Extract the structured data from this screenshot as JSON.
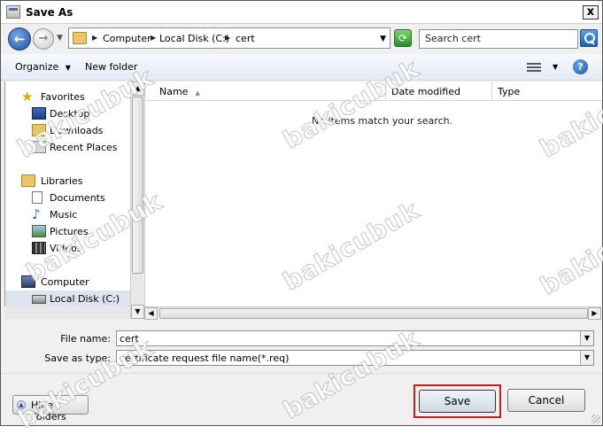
{
  "window": {
    "title": "Save As",
    "close_glyph": "x"
  },
  "address": {
    "back_glyph": "←",
    "forward_glyph": "→",
    "breadcrumbs": [
      "Computer",
      "Local Disk (C:)",
      "cert"
    ],
    "search_placeholder": "Search cert"
  },
  "toolbar": {
    "organize": "Organize",
    "new_folder": "New folder",
    "help_glyph": "?"
  },
  "nav": {
    "favorites": "Favorites",
    "desktop": "Desktop",
    "downloads": "Downloads",
    "recent": "Recent Places",
    "libraries": "Libraries",
    "documents": "Documents",
    "music": "Music",
    "pictures": "Pictures",
    "videos": "Videos",
    "computer": "Computer",
    "local_disk": "Local Disk (C:)"
  },
  "list": {
    "columns": [
      "Name",
      "Date modified",
      "Type"
    ],
    "empty_message": "No items match your search."
  },
  "form": {
    "file_name_label": "File name:",
    "file_name_value": "cert",
    "type_label": "Save as type:",
    "type_value": "certificate request file name(*.req)"
  },
  "buttons": {
    "hide_folders": "Hide Folders",
    "save": "Save",
    "cancel": "Cancel"
  },
  "watermark": "bakicubuk"
}
